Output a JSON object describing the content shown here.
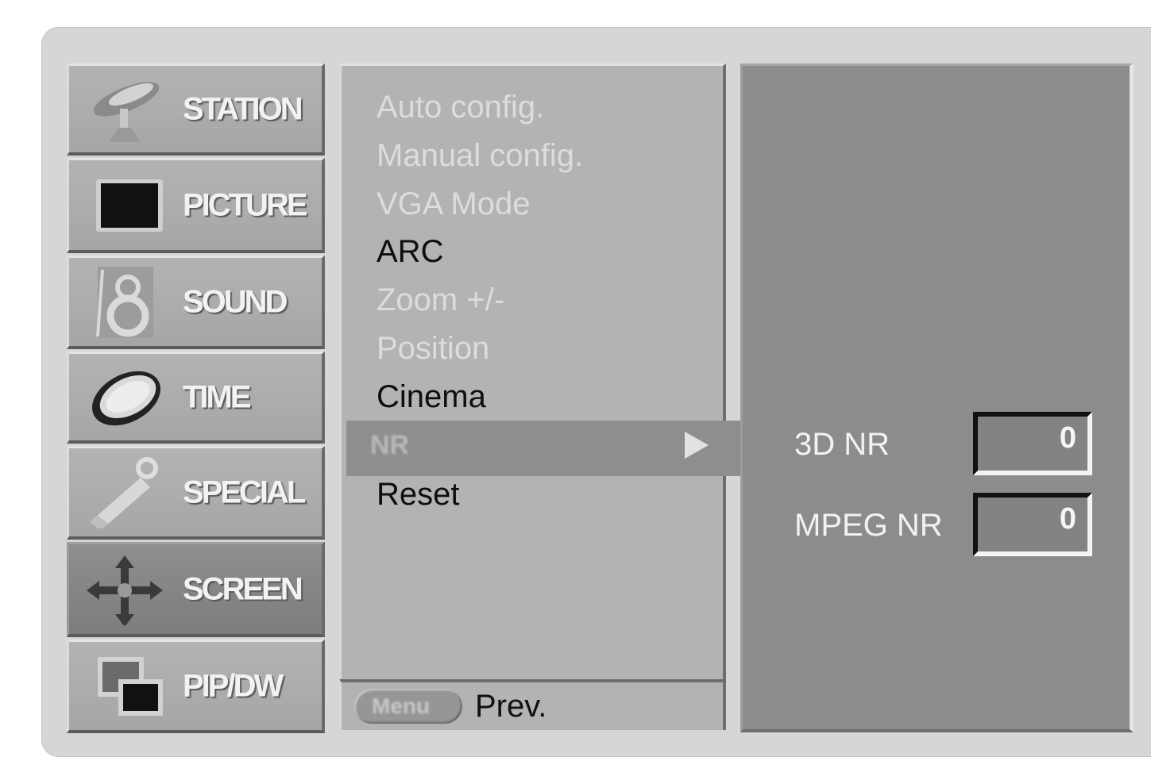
{
  "categories": [
    {
      "label": "STATION",
      "icon": "satellite-dish-icon",
      "selected": false
    },
    {
      "label": "PICTURE",
      "icon": "tv-screen-icon",
      "selected": false
    },
    {
      "label": "SOUND",
      "icon": "speaker-icon",
      "selected": false
    },
    {
      "label": "TIME",
      "icon": "clock-icon",
      "selected": false
    },
    {
      "label": "SPECIAL",
      "icon": "key-tag-icon",
      "selected": false
    },
    {
      "label": "SCREEN",
      "icon": "move-arrows-icon",
      "selected": true
    },
    {
      "label": "PIP/DW",
      "icon": "pip-windows-icon",
      "selected": false
    }
  ],
  "menu": {
    "items": [
      {
        "label": "Auto config.",
        "enabled": false
      },
      {
        "label": "Manual config.",
        "enabled": false
      },
      {
        "label": "VGA Mode",
        "enabled": false
      },
      {
        "label": "ARC",
        "enabled": true
      },
      {
        "label": "Zoom +/-",
        "enabled": false
      },
      {
        "label": "Position",
        "enabled": false
      },
      {
        "label": "Cinema",
        "enabled": true
      },
      {
        "label": "NR",
        "enabled": true,
        "highlighted": true
      },
      {
        "label": "Reset",
        "enabled": true
      }
    ]
  },
  "footer": {
    "key_label": "Menu",
    "prev_label": "Prev."
  },
  "nr_panel": {
    "rows": [
      {
        "label": "3D NR",
        "value": "0"
      },
      {
        "label": "MPEG NR",
        "value": "0"
      }
    ]
  },
  "colors": {
    "frame": "#d6d6d6",
    "category_bg": "#aeaeae",
    "selected_bg": "#858585",
    "highlight_bg": "#8e8e8e",
    "panel_bg": "#8c8c8c"
  }
}
